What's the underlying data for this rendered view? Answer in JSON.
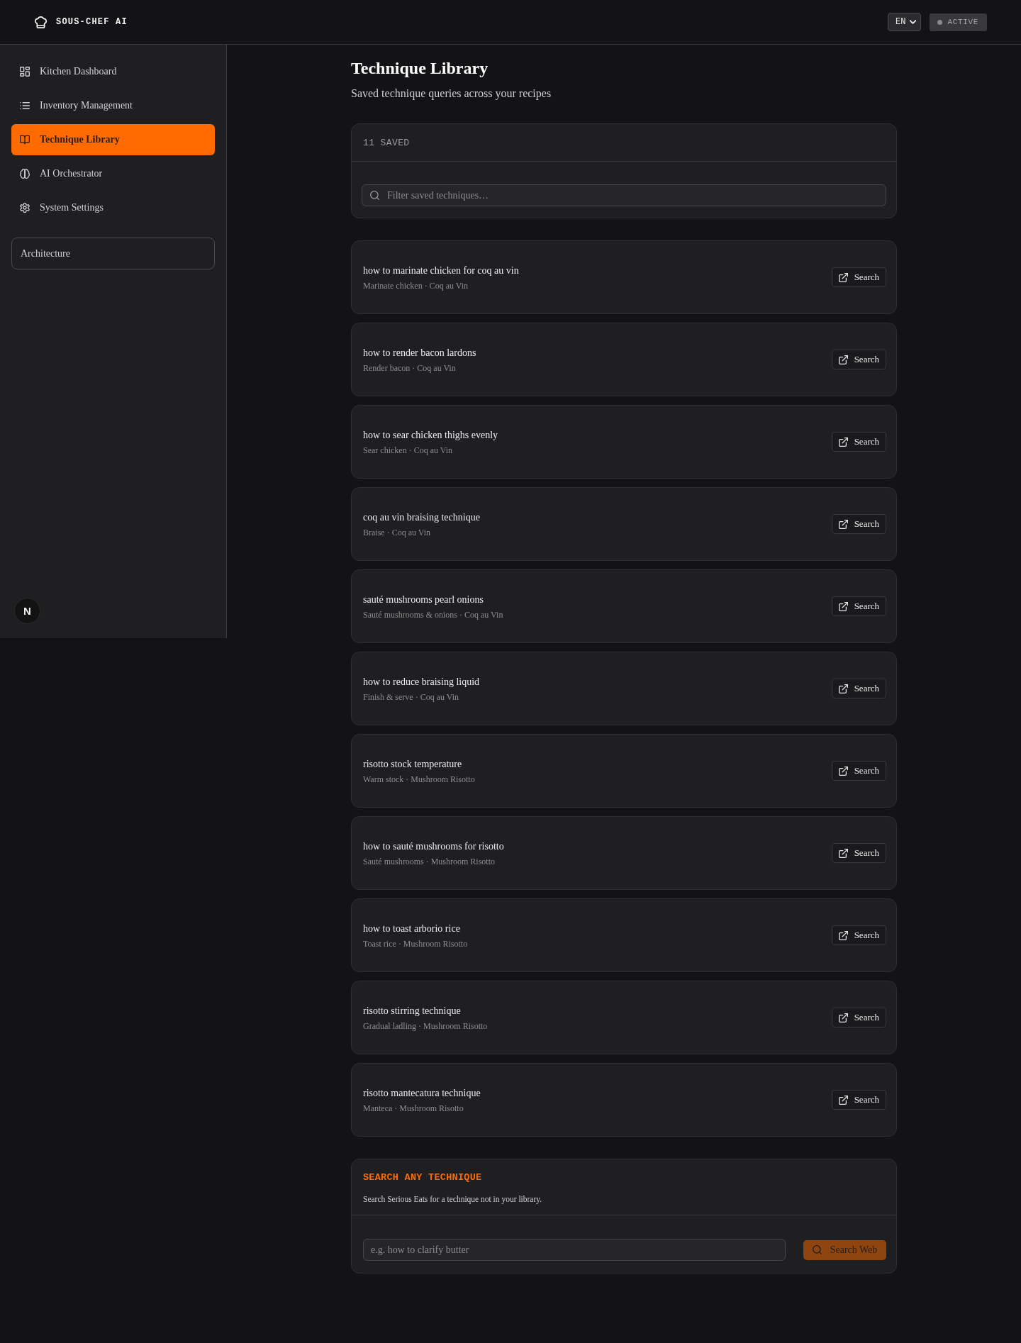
{
  "header": {
    "brand": "SOUS-CHEF AI",
    "language": "EN",
    "status": "ACTIVE"
  },
  "sidebar": {
    "items": [
      {
        "label": "Kitchen Dashboard",
        "selected": false
      },
      {
        "label": "Inventory Management",
        "selected": false
      },
      {
        "label": "Technique Library",
        "selected": true
      },
      {
        "label": "AI Orchestrator",
        "selected": false
      },
      {
        "label": "System Settings",
        "selected": false
      }
    ],
    "link": "Architecture",
    "badge": "N"
  },
  "page": {
    "title": "Technique Library",
    "subtitle": "Saved technique queries across your recipes"
  },
  "saved": {
    "count": "11 SAVED",
    "filter": {
      "placeholder": "Filter saved techniques…"
    }
  },
  "techniques": [
    {
      "query": "how to marinate chicken for coq au vin",
      "meta": "Marinate chicken · Coq au Vin",
      "action": "Search"
    },
    {
      "query": "how to render bacon lardons",
      "meta": "Render bacon · Coq au Vin",
      "action": "Search"
    },
    {
      "query": "how to sear chicken thighs evenly",
      "meta": "Sear chicken · Coq au Vin",
      "action": "Search"
    },
    {
      "query": "coq au vin braising technique",
      "meta": "Braise · Coq au Vin",
      "action": "Search"
    },
    {
      "query": "sauté mushrooms pearl onions",
      "meta": "Sauté mushrooms & onions · Coq au Vin",
      "action": "Search"
    },
    {
      "query": "how to reduce braising liquid",
      "meta": "Finish & serve · Coq au Vin",
      "action": "Search"
    },
    {
      "query": "risotto stock temperature",
      "meta": "Warm stock · Mushroom Risotto",
      "action": "Search"
    },
    {
      "query": "how to sauté mushrooms for risotto",
      "meta": "Sauté mushrooms · Mushroom Risotto",
      "action": "Search"
    },
    {
      "query": "how to toast arborio rice",
      "meta": "Toast rice · Mushroom Risotto",
      "action": "Search"
    },
    {
      "query": "risotto stirring technique",
      "meta": "Gradual ladling · Mushroom Risotto",
      "action": "Search"
    },
    {
      "query": "risotto mantecatura technique",
      "meta": "Manteca · Mushroom Risotto",
      "action": "Search"
    }
  ],
  "web_search": {
    "title": "SEARCH ANY TECHNIQUE",
    "description": "Search Serious Eats for a technique not in your library.",
    "input": {
      "placeholder": "e.g. how to clarify butter"
    },
    "button": {
      "label": "Search Web",
      "disabled": true
    }
  }
}
